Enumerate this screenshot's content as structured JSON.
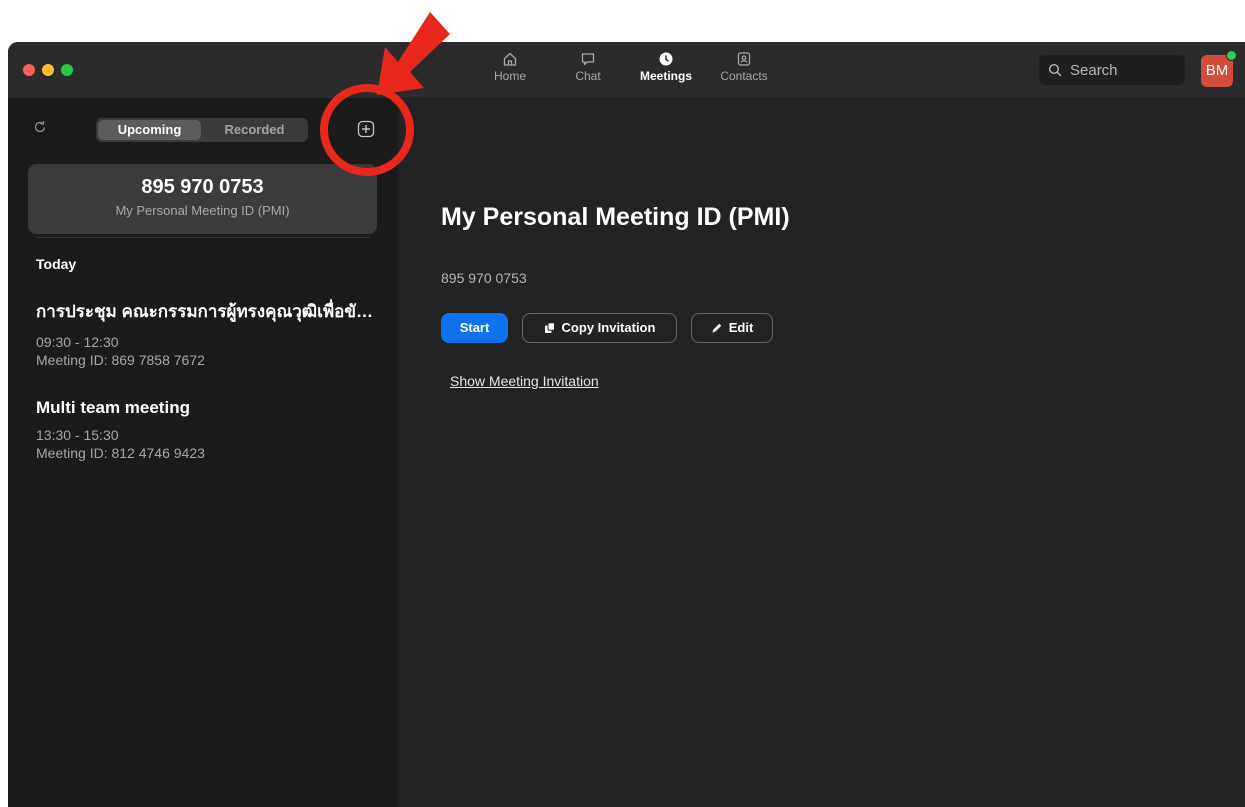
{
  "window": {
    "nav": [
      {
        "label": "Home",
        "icon": "home-icon"
      },
      {
        "label": "Chat",
        "icon": "chat-icon"
      },
      {
        "label": "Meetings",
        "icon": "clock-icon",
        "active": true
      },
      {
        "label": "Contacts",
        "icon": "contacts-icon"
      }
    ],
    "search_placeholder": "Search",
    "avatar_initials": "BM"
  },
  "sidebar": {
    "tabs": {
      "upcoming": "Upcoming",
      "recorded": "Recorded"
    },
    "pmi": {
      "number": "895 970 0753",
      "label": "My Personal Meeting ID (PMI)"
    },
    "section_today": "Today",
    "meetings": [
      {
        "title": "การประชุม คณะกรรมการผู้ทรงคุณวุฒิเพื่อขับเคลื่อน",
        "time": "09:30 - 12:30",
        "meeting_id": "Meeting ID: 869 7858 7672"
      },
      {
        "title": "Multi team meeting",
        "time": "13:30 - 15:30",
        "meeting_id": "Meeting ID: 812 4746 9423"
      }
    ]
  },
  "main": {
    "title": "My Personal Meeting ID (PMI)",
    "meeting_id": "895 970 0753",
    "start_label": "Start",
    "copy_label": "Copy Invitation",
    "edit_label": "Edit",
    "show_invitation_label": "Show Meeting Invitation"
  },
  "colors": {
    "accent_blue": "#0e72ed",
    "annotation_red": "#e8281d",
    "avatar_bg": "#d44b3d"
  }
}
